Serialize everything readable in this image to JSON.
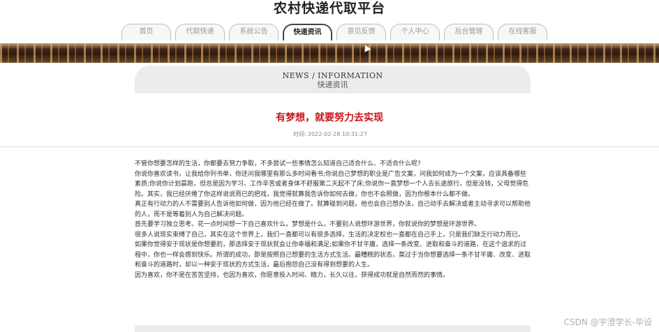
{
  "site": {
    "title": "农村快递代取平台"
  },
  "nav": {
    "tabs": [
      {
        "label": "首页",
        "active": false
      },
      {
        "label": "代取快递",
        "active": false
      },
      {
        "label": "系统公告",
        "active": false
      },
      {
        "label": "快递资讯",
        "active": true
      },
      {
        "label": "意见反馈",
        "active": false
      },
      {
        "label": "个人中心",
        "active": false
      },
      {
        "label": "后台管理",
        "active": false
      },
      {
        "label": "在线客服",
        "active": false
      }
    ]
  },
  "section": {
    "title_en": "NEWS / INFORMATION",
    "title_cn": "快递资讯"
  },
  "article": {
    "title": "有梦想，就要努力去实现",
    "time_label": "时间:",
    "time_value": "2022-02-28 10:31:27",
    "paragraphs": [
      "不管你想要怎样的生活，你都要去努力争取，不多尝试一些事情怎么知道自己适合什么、不适合什么呢?",
      "你说你喜欢读书，让我给你列书单，你还问我哪里有那么多时间看书;你说自己梦想的职业是广告文案，问我如何成为一个文案，应该具备哪些素质;你说你计划晨跑，但总是因为学习、工作辛苦或者身体不舒服第二天起不了床;你说你一直梦想一个人去长途旅行，但是没钱，父母觉得危险。其实，我已经厌倦了你这样说说而已的把戏，我觉得就算我告诉你如何去做，你也不会照做，因为你根本什么都不做。",
      "真正有行动力的人不需要别人告诉他如何做，因为他已经在做了。就算碰到问题，他也会自己想办法，自己动手去解决或者主动寻求可以帮助他的人，而不是等着别人为自己解决问题。",
      "首先要学习独立思考。花一点时间想一下自己喜欢什么，梦想是什么，不要别人说想环游世界，你就说你的梦想是环游世界。",
      "很多人说现实束缚了自己，其实在这个世界上，我们一直都可以有很多选择，生活的决定权也一直都在自己手上，只是我们缺乏行动力而已。",
      "如果你觉得安于现状是你想要的，那选择安于现状就会让你幸福和满足;如果你不甘平庸，选择一条改变、进取和奋斗的道路，在这个追求的过程中，你也一样会感到快乐。所谓的成功，即是按照自己想要的生活方式生活。最糟糕的状态，莫过于当你想要选择一条不甘平庸、改变、进取和奋斗的道路时，却以一种安于现状的方式生活，最后抱怨自己没有得到想要的人生。",
      "因为喜欢，你不是在苦苦坚持，也因为喜欢，你愿意投入时间、精力，长久以往，获得成功就是自然而然的事情。"
    ]
  },
  "watermark": "CSDN @宇澄学长-毕设"
}
